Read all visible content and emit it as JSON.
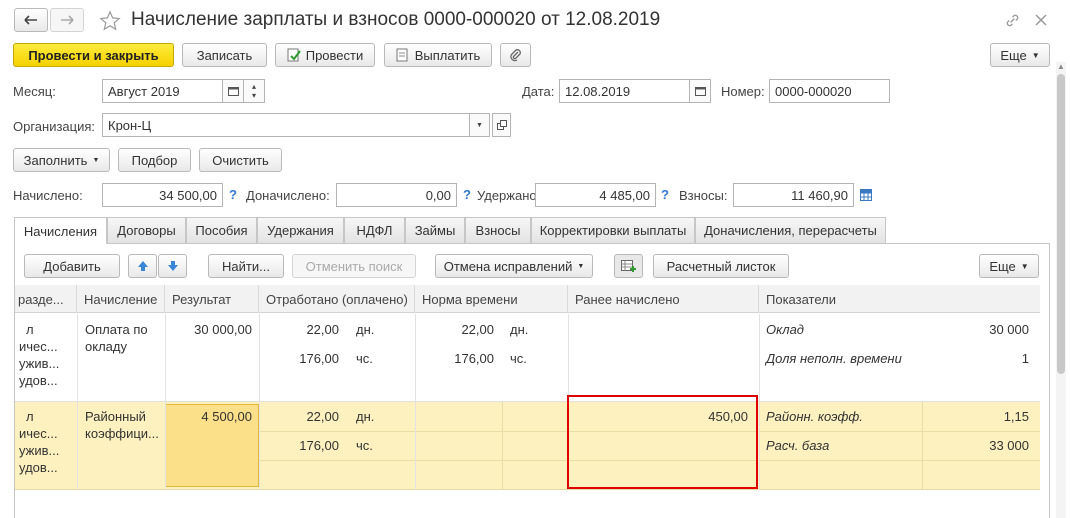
{
  "window": {
    "title": "Начисление зарплаты и взносов 0000-000020 от 12.08.2019"
  },
  "toolbar": {
    "post_close": "Провести и закрыть",
    "save": "Записать",
    "post": "Провести",
    "pay": "Выплатить",
    "more": "Еще"
  },
  "header": {
    "month_label": "Месяц:",
    "month_value": "Август 2019",
    "date_label": "Дата:",
    "date_value": "12.08.2019",
    "number_label": "Номер:",
    "number_value": "0000-000020",
    "org_label": "Организация:",
    "org_value": "Крон-Ц"
  },
  "actions": {
    "fill": "Заполнить",
    "select": "Подбор",
    "clear": "Очистить"
  },
  "totals": {
    "accrued_label": "Начислено:",
    "accrued_value": "34 500,00",
    "extra_label": "Доначислено:",
    "extra_value": "0,00",
    "withheld_label": "Удержано:",
    "withheld_value": "4 485,00",
    "contrib_label": "Взносы:",
    "contrib_value": "11 460,90",
    "help": "?"
  },
  "tabs": [
    "Начисления",
    "Договоры",
    "Пособия",
    "Удержания",
    "НДФЛ",
    "Займы",
    "Взносы",
    "Корректировки выплаты",
    "Доначисления, перерасчеты"
  ],
  "table_toolbar": {
    "add": "Добавить",
    "find": "Найти...",
    "cancel_search": "Отменить поиск",
    "cancel_fixes": "Отмена исправлений",
    "payslip": "Расчетный листок",
    "more": "Еще"
  },
  "table": {
    "headers": [
      "разде...",
      "Начисление",
      "Результат",
      "Отработано (оплачено)",
      "Норма времени",
      "Ранее начислено",
      "Показатели"
    ],
    "rows": [
      {
        "dept_lines": [
          "л",
          "ичес...",
          "ужив...",
          "удов..."
        ],
        "accrual_lines": [
          "Оплата по",
          "окладу"
        ],
        "result": "30 000,00",
        "worked": [
          "22,00",
          "176,00"
        ],
        "worked_units": [
          "дн.",
          "чс."
        ],
        "norm": [
          "22,00",
          "176,00"
        ],
        "norm_units": [
          "дн.",
          "чс."
        ],
        "earlier": "",
        "indicators": [
          {
            "name": "Оклад",
            "value": "30 000"
          },
          {
            "name": "Доля неполн. времени",
            "value": "1"
          }
        ]
      },
      {
        "dept_lines": [
          "л",
          "ичес...",
          "ужив...",
          "удов..."
        ],
        "accrual_lines": [
          "Районный",
          "коэффици..."
        ],
        "result": "4 500,00",
        "worked": [
          "22,00",
          "176,00"
        ],
        "worked_units": [
          "дн.",
          "чс."
        ],
        "norm": [
          "",
          ""
        ],
        "norm_units": [
          "",
          ""
        ],
        "earlier": "450,00",
        "indicators": [
          {
            "name": "Районн. коэфф.",
            "value": "1,15"
          },
          {
            "name": "Расч. база",
            "value": "33 000"
          }
        ]
      }
    ]
  },
  "colors": {
    "primary_button": "#f5d100",
    "selected_row": "#fdf1c0",
    "selected_cell": "#fbe089",
    "highlight_box": "#e00000"
  }
}
